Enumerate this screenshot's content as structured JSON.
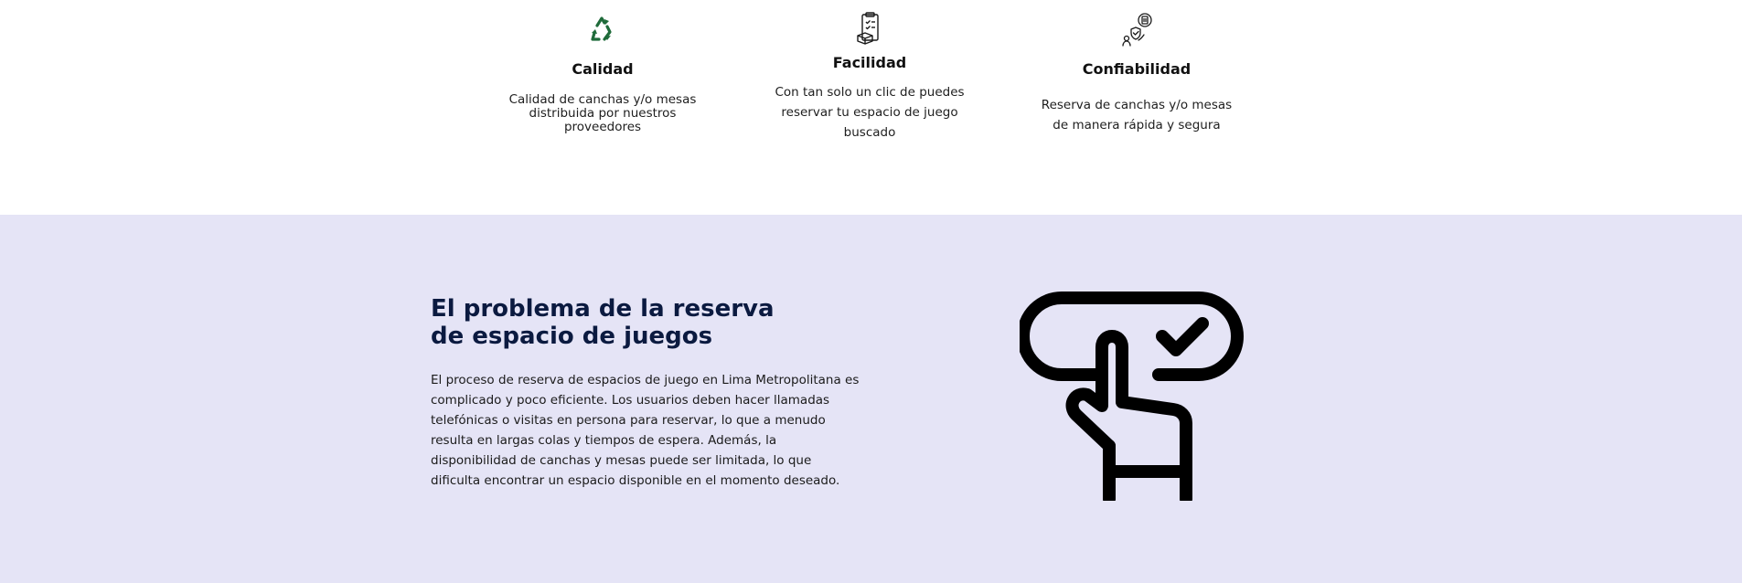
{
  "features": [
    {
      "title": "Calidad",
      "description": "Calidad de canchas y/o mesas distribuida por nuestros proveedores",
      "icon": "recycle-icon",
      "icon_color": "#1f6b3a"
    },
    {
      "title": "Facilidad",
      "description": "Con tan solo un clic de puedes reservar tu espacio de juego buscado",
      "icon": "checklist-document-icon",
      "icon_color": "#1a1a1a"
    },
    {
      "title": "Confiabilidad",
      "description": "Reserva de canchas y/o mesas de manera rápida y segura",
      "icon": "secure-booking-icon",
      "icon_color": "#1a1a1a"
    }
  ],
  "problem": {
    "title": "El problema de la reserva de espacio de juegos",
    "body": "El proceso de reserva de espacios de juego en Lima Metropolitana es complicado y poco eficiente. Los usuarios deben hacer llamadas telefónicas o visitas en persona para reservar, lo que a menudo resulta en largas colas y tiempos de espera. Además, la disponibilidad de canchas y mesas puede ser limitada, lo que dificulta encontrar un espacio disponible en el momento deseado.",
    "illustration": "hand-touch-check-icon",
    "background_color": "#e5e4f6",
    "title_color": "#0b1a40"
  }
}
